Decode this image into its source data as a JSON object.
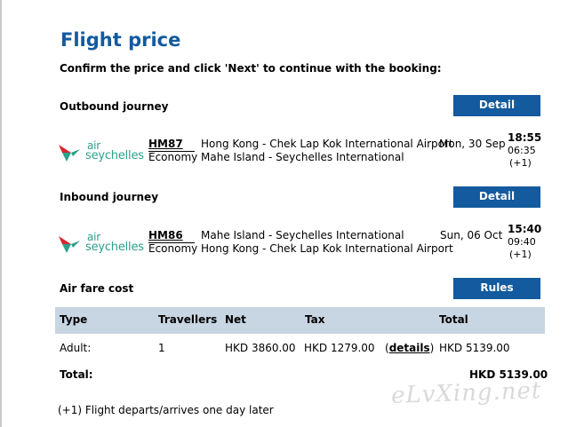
{
  "page": {
    "title": "Flight price",
    "instruction": "Confirm the price and click 'Next' to continue with the booking:"
  },
  "outbound": {
    "label": "Outbound journey",
    "detail_button": "Detail",
    "airline_logo": {
      "prefix": "air",
      "name": "seychelles"
    },
    "flight_no": "HM87",
    "cabin": "Economy",
    "from": "Hong Kong - Chek Lap Kok International Airport",
    "to": "Mahe Island - Seychelles International",
    "date": "Mon, 30 Sep",
    "dep_time": "18:55",
    "arr_time": "06:35",
    "day_offset": "(+1)"
  },
  "inbound": {
    "label": "Inbound journey",
    "detail_button": "Detail",
    "airline_logo": {
      "prefix": "air",
      "name": "seychelles"
    },
    "flight_no": "HM86",
    "cabin": "Economy",
    "from": "Mahe Island - Seychelles International",
    "to": "Hong Kong - Chek Lap Kok International Airport",
    "date": "Sun, 06 Oct",
    "dep_time": "15:40",
    "arr_time": "09:40",
    "day_offset": "(+1)"
  },
  "fare": {
    "label": "Air fare cost",
    "rules_button": "Rules",
    "columns": [
      "Type",
      "Travellers",
      "Net",
      "Tax",
      "Total"
    ],
    "row": {
      "type": "Adult:",
      "travellers": "1",
      "net": "HKD 3860.00",
      "tax": "HKD 1279.00",
      "details_open": "(",
      "details_link": "details",
      "details_close": ")",
      "total": "HKD 5139.00"
    },
    "total_label": "Total:",
    "total_value": "HKD 5139.00"
  },
  "footnote": "(+1) Flight departs/arrives one day later",
  "watermark": "eLvXing.net",
  "colors": {
    "brand_blue": "#135a9e",
    "header_bg": "#c8d6e3",
    "logo_green": "#2ba08c",
    "logo_red": "#d8262e"
  }
}
